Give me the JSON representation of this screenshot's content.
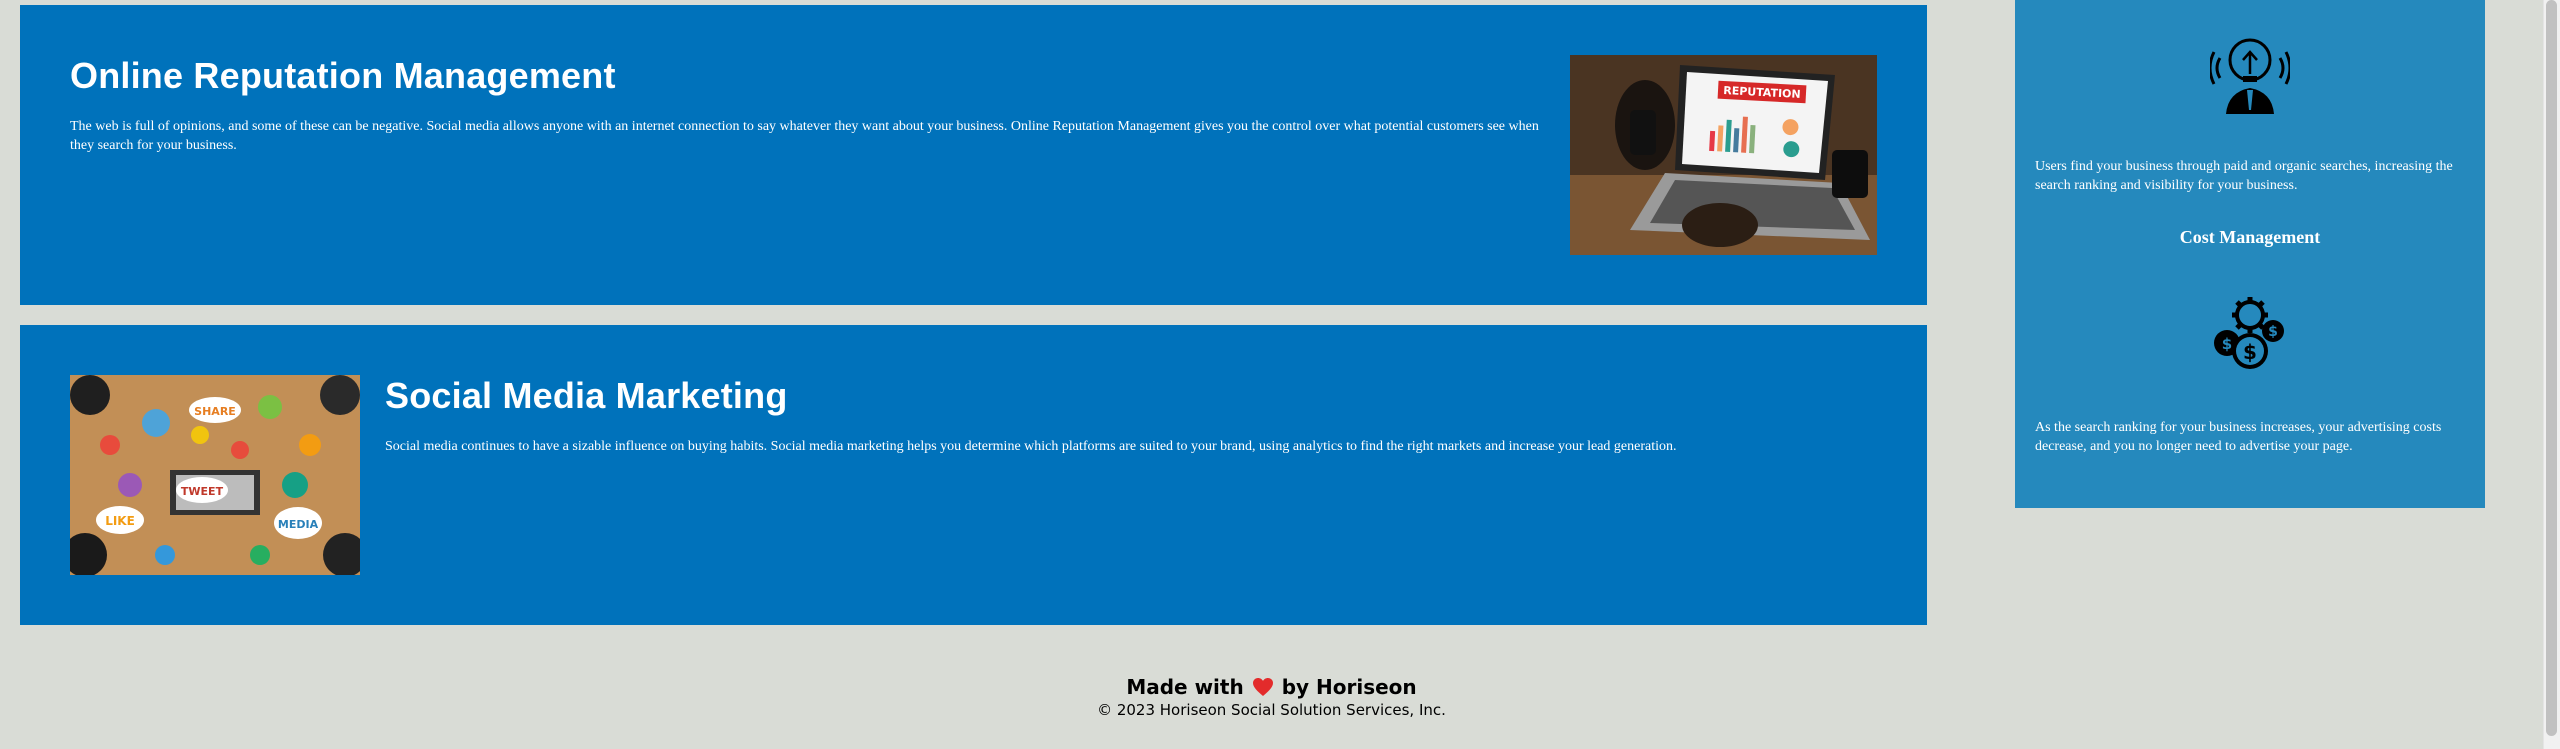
{
  "sections": {
    "orm": {
      "title": "Online Reputation Management",
      "body": "The web is full of opinions, and some of these can be negative. Social media allows anyone with an internet connection to say whatever they want about your business. Online Reputation Management gives you the control over what potential customers see when they search for your business.",
      "image_label": "REPUTATION"
    },
    "smm": {
      "title": "Social Media Marketing",
      "body": "Social media continues to have a sizable influence on buying habits. Social media marketing helps you determine which platforms are suited to your brand, using analytics to find the right markets and increase your lead generation.",
      "image_words": [
        "SHARE",
        "TWEET",
        "LIKE",
        "MEDIA"
      ]
    }
  },
  "sidebar": {
    "lead_body": "Users find your business through paid and organic searches, increasing the search ranking and visibility for your business.",
    "cost_title": "Cost Management",
    "cost_body": "As the search ranking for your business increases, your advertising costs decrease, and you no longer need to advertise your page."
  },
  "footer": {
    "made_with": "Made with",
    "by": "by Horiseon",
    "heart_icon": "heart-icon",
    "copyright": "© 2023 Horiseon Social Solution Services, Inc."
  },
  "colors": {
    "background": "#d9dcd6",
    "card": "#0072bb",
    "sidebar": "#2589bd",
    "heart": "#e32b2b"
  }
}
